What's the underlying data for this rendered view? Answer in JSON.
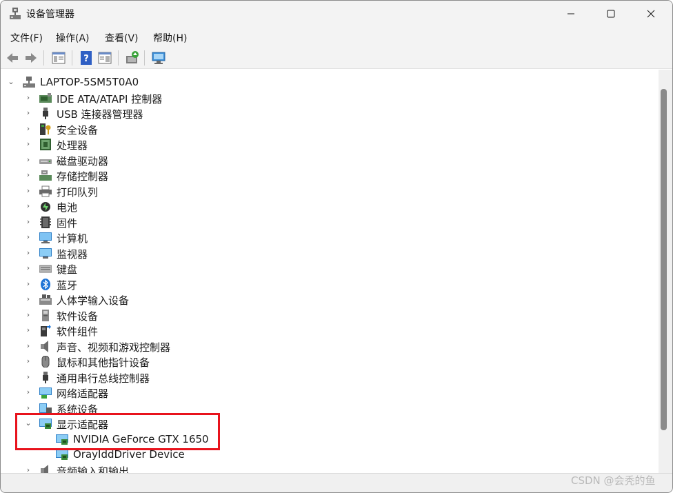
{
  "window": {
    "title": "设备管理器"
  },
  "menu": [
    "文件(F)",
    "操作(A)",
    "查看(V)",
    "帮助(H)"
  ],
  "tree": {
    "root": "LAPTOP-5SM5T0A0",
    "categories": [
      {
        "label": "IDE ATA/ATAPI 控制器",
        "icon": "ide-controller-icon"
      },
      {
        "label": "USB 连接器管理器",
        "icon": "usb-icon"
      },
      {
        "label": "安全设备",
        "icon": "security-device-icon"
      },
      {
        "label": "处理器",
        "icon": "processor-icon"
      },
      {
        "label": "磁盘驱动器",
        "icon": "disk-drive-icon"
      },
      {
        "label": "存储控制器",
        "icon": "storage-controller-icon"
      },
      {
        "label": "打印队列",
        "icon": "printer-icon"
      },
      {
        "label": "电池",
        "icon": "battery-icon"
      },
      {
        "label": "固件",
        "icon": "firmware-icon"
      },
      {
        "label": "计算机",
        "icon": "computer-icon"
      },
      {
        "label": "监视器",
        "icon": "monitor-icon"
      },
      {
        "label": "键盘",
        "icon": "keyboard-icon"
      },
      {
        "label": "蓝牙",
        "icon": "bluetooth-icon"
      },
      {
        "label": "人体学输入设备",
        "icon": "hid-icon"
      },
      {
        "label": "软件设备",
        "icon": "software-device-icon"
      },
      {
        "label": "软件组件",
        "icon": "software-component-icon"
      },
      {
        "label": "声音、视频和游戏控制器",
        "icon": "speaker-icon"
      },
      {
        "label": "鼠标和其他指针设备",
        "icon": "mouse-icon"
      },
      {
        "label": "通用串行总线控制器",
        "icon": "usb-controller-icon"
      },
      {
        "label": "网络适配器",
        "icon": "network-adapter-icon"
      },
      {
        "label": "系统设备",
        "icon": "system-device-icon"
      }
    ],
    "display": {
      "label": "显示适配器",
      "children": [
        "NVIDIA GeForce GTX 1650",
        "OrayIddDriver Device"
      ]
    },
    "last": "音频输入和输出"
  },
  "watermark": "CSDN @会秃的鱼",
  "colors": {
    "highlight": "#e8131c",
    "titlebar": "#f3f3f3"
  }
}
